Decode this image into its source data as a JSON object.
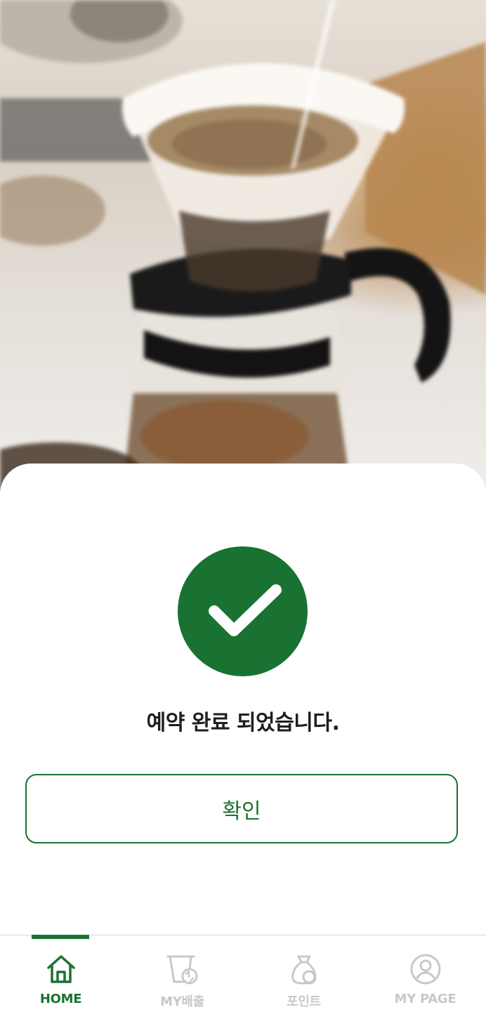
{
  "colors": {
    "brand_green": "#197232",
    "inactive_gray": "#c8c8c8",
    "text_dark": "#1e1e1e"
  },
  "background": {
    "icon": "coffee-dripper-photo"
  },
  "modal": {
    "icon": "check-icon",
    "message": "예약 완료 되었습니다.",
    "confirm_label": "확인"
  },
  "nav": {
    "items": [
      {
        "label": "HOME",
        "icon": "home-icon",
        "active": true
      },
      {
        "label": "MY배출",
        "icon": "recycle-bin-icon",
        "active": false
      },
      {
        "label": "포인트",
        "icon": "point-bag-icon",
        "active": false
      },
      {
        "label": "MY PAGE",
        "icon": "user-icon",
        "active": false
      }
    ]
  }
}
